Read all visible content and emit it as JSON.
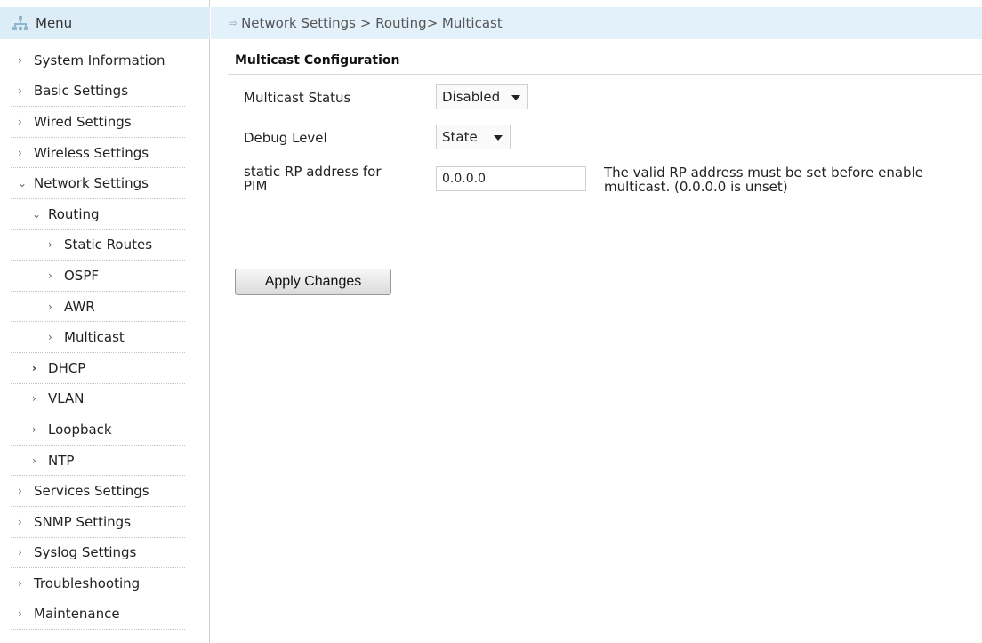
{
  "menu": {
    "title": "Menu"
  },
  "sidebar": {
    "items": [
      {
        "label": "System Information",
        "level": 1,
        "chevron": "›"
      },
      {
        "label": "Basic Settings",
        "level": 1,
        "chevron": "›"
      },
      {
        "label": "Wired Settings",
        "level": 1,
        "chevron": "›"
      },
      {
        "label": "Wireless Settings",
        "level": 1,
        "chevron": "›"
      },
      {
        "label": "Network Settings",
        "level": 1,
        "chevron": "⌄"
      },
      {
        "label": "Routing",
        "level": 2,
        "chevron": "⌄"
      },
      {
        "label": "Static Routes",
        "level": 3,
        "chevron": "›"
      },
      {
        "label": "OSPF",
        "level": 3,
        "chevron": "›"
      },
      {
        "label": "AWR",
        "level": 3,
        "chevron": "›"
      },
      {
        "label": "Multicast",
        "level": 3,
        "chevron": "›"
      },
      {
        "label": "DHCP",
        "level": 2,
        "chevron": "›"
      },
      {
        "label": "VLAN",
        "level": 2,
        "chevron": "›"
      },
      {
        "label": "Loopback",
        "level": 2,
        "chevron": "›"
      },
      {
        "label": "NTP",
        "level": 2,
        "chevron": "›"
      },
      {
        "label": "Services Settings",
        "level": 1,
        "chevron": "›"
      },
      {
        "label": "SNMP Settings",
        "level": 1,
        "chevron": "›"
      },
      {
        "label": "Syslog Settings",
        "level": 1,
        "chevron": "›"
      },
      {
        "label": "Troubleshooting",
        "level": 1,
        "chevron": "›"
      },
      {
        "label": "Maintenance",
        "level": 1,
        "chevron": "›"
      }
    ]
  },
  "breadcrumb": {
    "arrow": "⇨",
    "text": "Network Settings > Routing> Multicast"
  },
  "main": {
    "title": "Multicast Configuration",
    "fields": {
      "status": {
        "label": "Multicast Status",
        "value": "Disabled"
      },
      "debug": {
        "label": "Debug Level",
        "value": "State"
      },
      "rp": {
        "label_line1": "static RP address for",
        "label_line2": "PIM",
        "value": "0.0.0.0",
        "hint_line1": "The valid RP address must be set before enable",
        "hint_line2": "multicast. (0.0.0.0 is unset)"
      }
    },
    "apply_label": "Apply Changes"
  },
  "colors": {
    "header_bg": "#dcedf8",
    "breadcrumb_bg": "#e3f1fb"
  }
}
